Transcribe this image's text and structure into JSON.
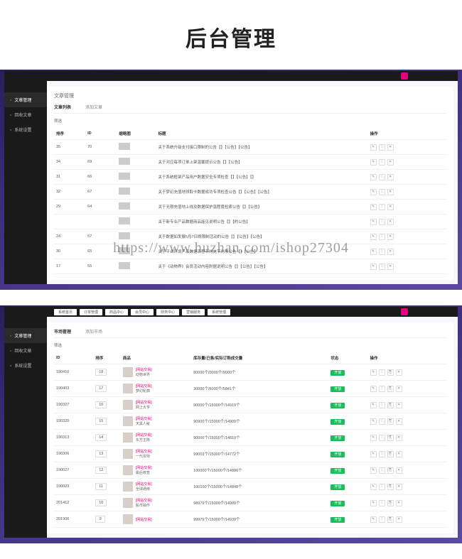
{
  "hero": "后台管理",
  "watermark": "https://www.huzhan.com/ishop27304",
  "sidebar": [
    {
      "label": "文章管理",
      "active": true
    },
    {
      "label": "回收文章",
      "active": false
    },
    {
      "label": "系统设置",
      "active": false
    }
  ],
  "topnav2": [
    "系统首页",
    "订单管理",
    "商品中心",
    "会员中心",
    "财务中心",
    "营销服务",
    "系统管理"
  ],
  "panel1": {
    "title": "文章管理",
    "tabs": [
      "文章列表",
      "添加文章"
    ],
    "filter": "筛选",
    "headers": [
      "排序",
      "ID",
      "缩略图",
      "标题",
      "操作"
    ],
    "rows": [
      {
        "o": "35",
        "id": "70",
        "t": "关于系统升级支付接口限制的公告【】【公告】【公告】"
      },
      {
        "o": "34",
        "id": "69",
        "t": "关于对应每项订单上架温馨提示公告【】【公告】"
      },
      {
        "o": "31",
        "id": "66",
        "t": "关于系统框架产品用户数据安全专项检查【】【公告】【】"
      },
      {
        "o": "32",
        "id": "67",
        "t": "关于梦幻充值地领取卡数据成功专项检查公告【】【公告】【公告】"
      },
      {
        "o": "29",
        "id": "64",
        "t": "关于无限充值地上线及数据保护温程度检索公告【】【公告】"
      },
      {
        "o": "",
        "id": "",
        "t": "关于新专业产品数据商品能见说明公告【】【的公告】"
      },
      {
        "o": "24",
        "id": "57",
        "t": "关于数据如发展5月7日晚限制活动的公告【】【公告】【公告】"
      },
      {
        "o": "30",
        "id": "65",
        "t": "关于平台环境产品数据流程节约充节约项公告【】【公告】"
      },
      {
        "o": "17",
        "id": "55",
        "t": "关于《动物界》会员活动内容附据说明公告【】【公告】【公告】"
      }
    ]
  },
  "panel2": {
    "tabs": [
      "市场管理",
      "添加市场"
    ],
    "filter": "筛选",
    "headers": [
      "ID",
      "排序",
      "商品",
      "库存量/已售/实际订购成交量",
      "状态",
      "操作"
    ],
    "status_label": "开放",
    "rows": [
      {
        "id": "190410",
        "o": "18",
        "cat": "[网站交易]",
        "name": "动物世界",
        "stk": "80000个/0000个/9000个"
      },
      {
        "id": "190403",
        "o": "17",
        "cat": "[网站交易]",
        "name": "梦幻轮廓",
        "stk": "30000个/6000个/5841个"
      },
      {
        "id": "190327",
        "o": "16",
        "cat": "[网站交易]",
        "name": "网上大亨",
        "stk": "90000个/15000个/14919个"
      },
      {
        "id": "190320",
        "o": "15",
        "cat": "[网站交易]",
        "name": "天黑人秘",
        "stk": "90900个/15000个/14909个"
      },
      {
        "id": "190313",
        "o": "14",
        "cat": "[网站交易]",
        "name": "东方主阵",
        "stk": "90000个/15000个/14810个"
      },
      {
        "id": "190306",
        "o": "13",
        "cat": "[网站交易]",
        "name": "一代宗师",
        "stk": "99003个/15000个/14772个"
      },
      {
        "id": "190027",
        "o": "12",
        "cat": "[网站交易]",
        "name": "最后核查",
        "stk": "100000个/15000个/14886个"
      },
      {
        "id": "190023",
        "o": "11",
        "cat": "[网站交易]",
        "name": "全球通用",
        "stk": "100100个/15000个/14848个"
      },
      {
        "id": "201412",
        "o": "10",
        "cat": "[网站交易]",
        "name": "股市操作",
        "stk": "98979个/15000个/14909个"
      },
      {
        "id": "201906",
        "o": "9",
        "cat": "[网站交易]",
        "name": "",
        "stk": "99979个/15000个/14939个"
      }
    ]
  }
}
